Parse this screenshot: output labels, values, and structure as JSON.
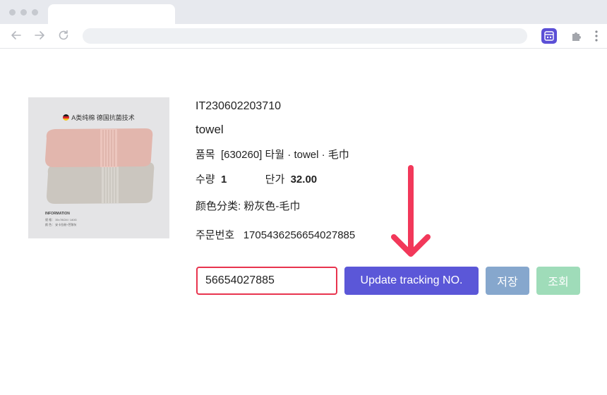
{
  "browser": {
    "colors": {
      "tabbar": "#e7e9ee",
      "extension_accent": "#5b4fd6"
    },
    "icons": [
      "back-arrow-icon",
      "forward-arrow-icon",
      "reload-icon",
      "extension-icon",
      "puzzle-icon",
      "menu-dots-icon"
    ]
  },
  "product": {
    "image": {
      "caption": "A类纯棉 德国抗菌技术",
      "info_title": "INFORMATION",
      "info_line1": "规    格：  35×78CM / 140G",
      "info_line2": "颜    色：  安卡拉粉+芭黎灰"
    },
    "sku": "IT230602203710",
    "name": "towel",
    "category_label": "품목",
    "category_value": "[630260]  타월 · towel · 毛巾",
    "qty_label": "수량",
    "qty_value": "1",
    "price_label": "단가",
    "price_value": "32.00",
    "variant": "颜色分类: 粉灰色-毛巾",
    "order_label": "주문번호",
    "order_number": "1705436256654027885"
  },
  "tracking": {
    "input_value": "56654027885",
    "update_label": "Update tracking NO.",
    "save_label": "저장",
    "query_label": "조회"
  },
  "colors": {
    "input_border": "#e8344e",
    "update_button": "#5b57d8",
    "save_button": "#86a7cd",
    "query_button": "#9fdcb9",
    "arrow": "#f2385a"
  }
}
